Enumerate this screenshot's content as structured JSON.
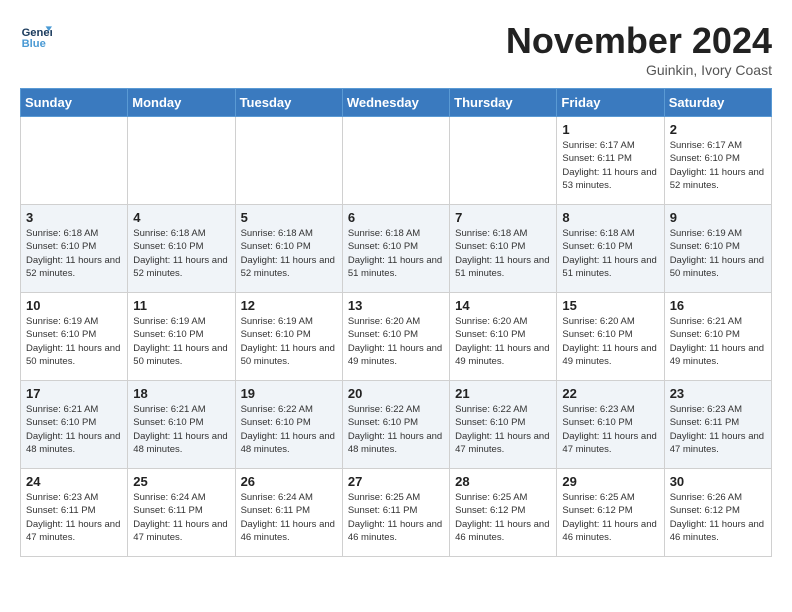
{
  "header": {
    "logo_line1": "General",
    "logo_line2": "Blue",
    "month_title": "November 2024",
    "location": "Guinkin, Ivory Coast"
  },
  "weekdays": [
    "Sunday",
    "Monday",
    "Tuesday",
    "Wednesday",
    "Thursday",
    "Friday",
    "Saturday"
  ],
  "weeks": [
    [
      {
        "day": "",
        "info": ""
      },
      {
        "day": "",
        "info": ""
      },
      {
        "day": "",
        "info": ""
      },
      {
        "day": "",
        "info": ""
      },
      {
        "day": "",
        "info": ""
      },
      {
        "day": "1",
        "info": "Sunrise: 6:17 AM\nSunset: 6:11 PM\nDaylight: 11 hours and 53 minutes."
      },
      {
        "day": "2",
        "info": "Sunrise: 6:17 AM\nSunset: 6:10 PM\nDaylight: 11 hours and 52 minutes."
      }
    ],
    [
      {
        "day": "3",
        "info": "Sunrise: 6:18 AM\nSunset: 6:10 PM\nDaylight: 11 hours and 52 minutes."
      },
      {
        "day": "4",
        "info": "Sunrise: 6:18 AM\nSunset: 6:10 PM\nDaylight: 11 hours and 52 minutes."
      },
      {
        "day": "5",
        "info": "Sunrise: 6:18 AM\nSunset: 6:10 PM\nDaylight: 11 hours and 52 minutes."
      },
      {
        "day": "6",
        "info": "Sunrise: 6:18 AM\nSunset: 6:10 PM\nDaylight: 11 hours and 51 minutes."
      },
      {
        "day": "7",
        "info": "Sunrise: 6:18 AM\nSunset: 6:10 PM\nDaylight: 11 hours and 51 minutes."
      },
      {
        "day": "8",
        "info": "Sunrise: 6:18 AM\nSunset: 6:10 PM\nDaylight: 11 hours and 51 minutes."
      },
      {
        "day": "9",
        "info": "Sunrise: 6:19 AM\nSunset: 6:10 PM\nDaylight: 11 hours and 50 minutes."
      }
    ],
    [
      {
        "day": "10",
        "info": "Sunrise: 6:19 AM\nSunset: 6:10 PM\nDaylight: 11 hours and 50 minutes."
      },
      {
        "day": "11",
        "info": "Sunrise: 6:19 AM\nSunset: 6:10 PM\nDaylight: 11 hours and 50 minutes."
      },
      {
        "day": "12",
        "info": "Sunrise: 6:19 AM\nSunset: 6:10 PM\nDaylight: 11 hours and 50 minutes."
      },
      {
        "day": "13",
        "info": "Sunrise: 6:20 AM\nSunset: 6:10 PM\nDaylight: 11 hours and 49 minutes."
      },
      {
        "day": "14",
        "info": "Sunrise: 6:20 AM\nSunset: 6:10 PM\nDaylight: 11 hours and 49 minutes."
      },
      {
        "day": "15",
        "info": "Sunrise: 6:20 AM\nSunset: 6:10 PM\nDaylight: 11 hours and 49 minutes."
      },
      {
        "day": "16",
        "info": "Sunrise: 6:21 AM\nSunset: 6:10 PM\nDaylight: 11 hours and 49 minutes."
      }
    ],
    [
      {
        "day": "17",
        "info": "Sunrise: 6:21 AM\nSunset: 6:10 PM\nDaylight: 11 hours and 48 minutes."
      },
      {
        "day": "18",
        "info": "Sunrise: 6:21 AM\nSunset: 6:10 PM\nDaylight: 11 hours and 48 minutes."
      },
      {
        "day": "19",
        "info": "Sunrise: 6:22 AM\nSunset: 6:10 PM\nDaylight: 11 hours and 48 minutes."
      },
      {
        "day": "20",
        "info": "Sunrise: 6:22 AM\nSunset: 6:10 PM\nDaylight: 11 hours and 48 minutes."
      },
      {
        "day": "21",
        "info": "Sunrise: 6:22 AM\nSunset: 6:10 PM\nDaylight: 11 hours and 47 minutes."
      },
      {
        "day": "22",
        "info": "Sunrise: 6:23 AM\nSunset: 6:10 PM\nDaylight: 11 hours and 47 minutes."
      },
      {
        "day": "23",
        "info": "Sunrise: 6:23 AM\nSunset: 6:11 PM\nDaylight: 11 hours and 47 minutes."
      }
    ],
    [
      {
        "day": "24",
        "info": "Sunrise: 6:23 AM\nSunset: 6:11 PM\nDaylight: 11 hours and 47 minutes."
      },
      {
        "day": "25",
        "info": "Sunrise: 6:24 AM\nSunset: 6:11 PM\nDaylight: 11 hours and 47 minutes."
      },
      {
        "day": "26",
        "info": "Sunrise: 6:24 AM\nSunset: 6:11 PM\nDaylight: 11 hours and 46 minutes."
      },
      {
        "day": "27",
        "info": "Sunrise: 6:25 AM\nSunset: 6:11 PM\nDaylight: 11 hours and 46 minutes."
      },
      {
        "day": "28",
        "info": "Sunrise: 6:25 AM\nSunset: 6:12 PM\nDaylight: 11 hours and 46 minutes."
      },
      {
        "day": "29",
        "info": "Sunrise: 6:25 AM\nSunset: 6:12 PM\nDaylight: 11 hours and 46 minutes."
      },
      {
        "day": "30",
        "info": "Sunrise: 6:26 AM\nSunset: 6:12 PM\nDaylight: 11 hours and 46 minutes."
      }
    ]
  ]
}
